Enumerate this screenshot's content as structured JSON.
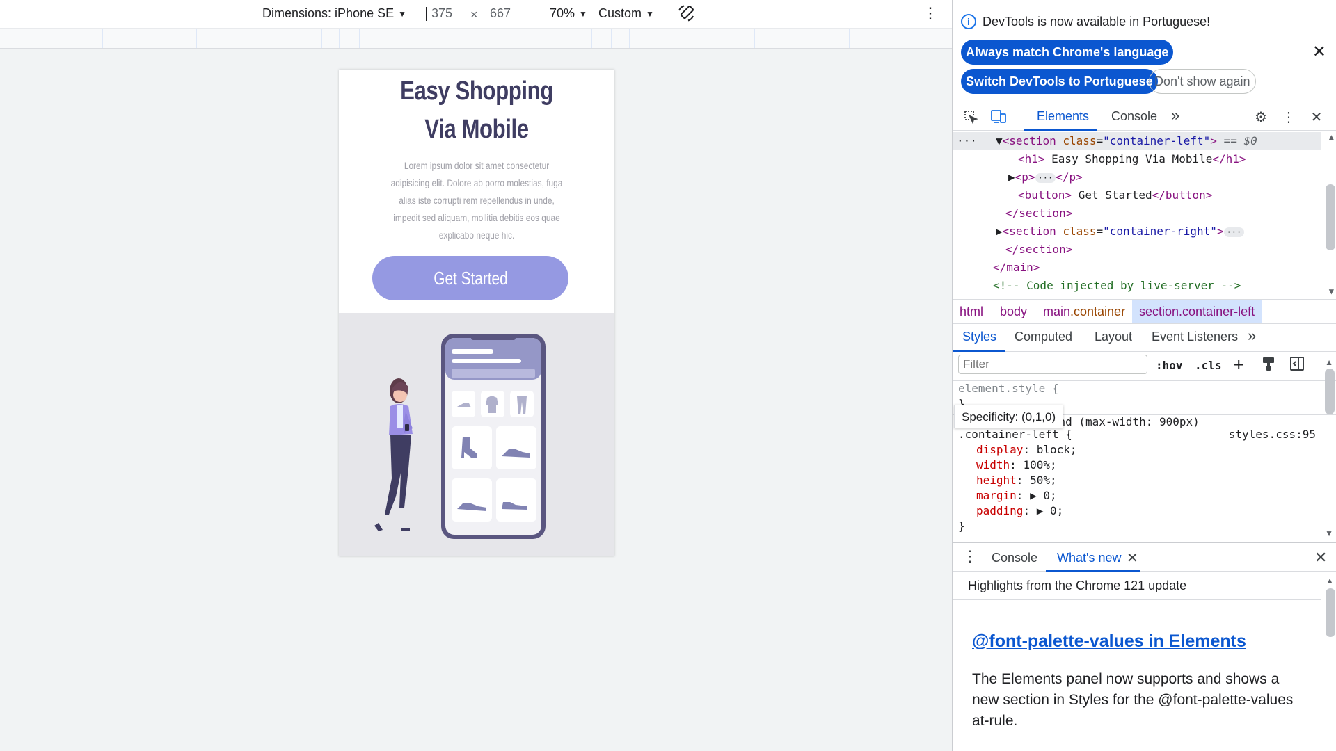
{
  "device_toolbar": {
    "dimensions_label": "Dimensions: iPhone SE",
    "width": "375",
    "times": "×",
    "height": "667",
    "zoom": "70%",
    "throttle": "Custom"
  },
  "page": {
    "title": "Easy Shopping Via Mobile",
    "description": "Lorem ipsum dolor sit amet consectetur adipisicing elit. Dolore ab porro molestias, fuga alias iste corrupti rem repellendus in unde, impedit sed aliquam, mollitia debitis eos quae explicabo neque hic.",
    "button_label": "Get Started",
    "colors": {
      "title": "#3f3d62",
      "button": "#9599e2",
      "illustration_bg": "#e6e6ea",
      "phone_frame": "#5a5680"
    }
  },
  "devtools": {
    "notification": {
      "message": "DevTools is now available in Portuguese!",
      "match_language": "Always match Chrome's language",
      "switch_language": "Switch DevTools to Portuguese",
      "dont_show": "Don't show again"
    },
    "tabs": {
      "elements": "Elements",
      "console": "Console"
    },
    "dom": {
      "line1_open": "<section",
      "line1_attr": "class",
      "line1_val": "\"container-left\"",
      "line1_close": ">",
      "line1_ref": "== $0",
      "h1_open": "<h1>",
      "h1_text": " Easy Shopping Via Mobile",
      "h1_close": "</h1>",
      "p_open": "<p>",
      "p_close": "</p>",
      "button_open": "<button>",
      "button_text": " Get Started",
      "button_close": "</button>",
      "section_close": "</section>",
      "section2_open": "<section",
      "section2_attr": "class",
      "section2_val": "\"container-right\"",
      "section2_close": ">",
      "section2_end": "</section>",
      "main_close": "</main>",
      "comment": "<!-- Code injected by live-server -->"
    },
    "breadcrumbs": {
      "html": "html",
      "body": "body",
      "main_tag": "main",
      "main_class": ".container",
      "selected": "section.container-left"
    },
    "style_tabs": {
      "styles": "Styles",
      "computed": "Computed",
      "layout": "Layout",
      "listeners": "Event Listeners"
    },
    "filter": {
      "placeholder": "Filter",
      "hov": ":hov",
      "cls": ".cls"
    },
    "rules": {
      "element_style": "element.style {",
      "element_style_close": "}",
      "tooltip": "Specificity: (0,1,0)",
      "media": "@media screen and (max-width: 900px)",
      "selector": ".container-left {",
      "source": "styles.css:95",
      "decls": [
        {
          "prop": "display",
          "val": "block;"
        },
        {
          "prop": "width",
          "val": "100%;"
        },
        {
          "prop": "height",
          "val": "50%;"
        },
        {
          "prop": "margin",
          "val": "▶ 0;"
        },
        {
          "prop": "padding",
          "val": "▶ 0;"
        }
      ],
      "close": "}"
    },
    "drawer": {
      "console": "Console",
      "whats_new": "What's new",
      "highlights": "Highlights from the Chrome 121 update",
      "feature_title": "@font-palette-values in Elements",
      "feature_desc": "The Elements panel now supports and shows a new section in Styles for the @font-palette-values at-rule."
    }
  }
}
